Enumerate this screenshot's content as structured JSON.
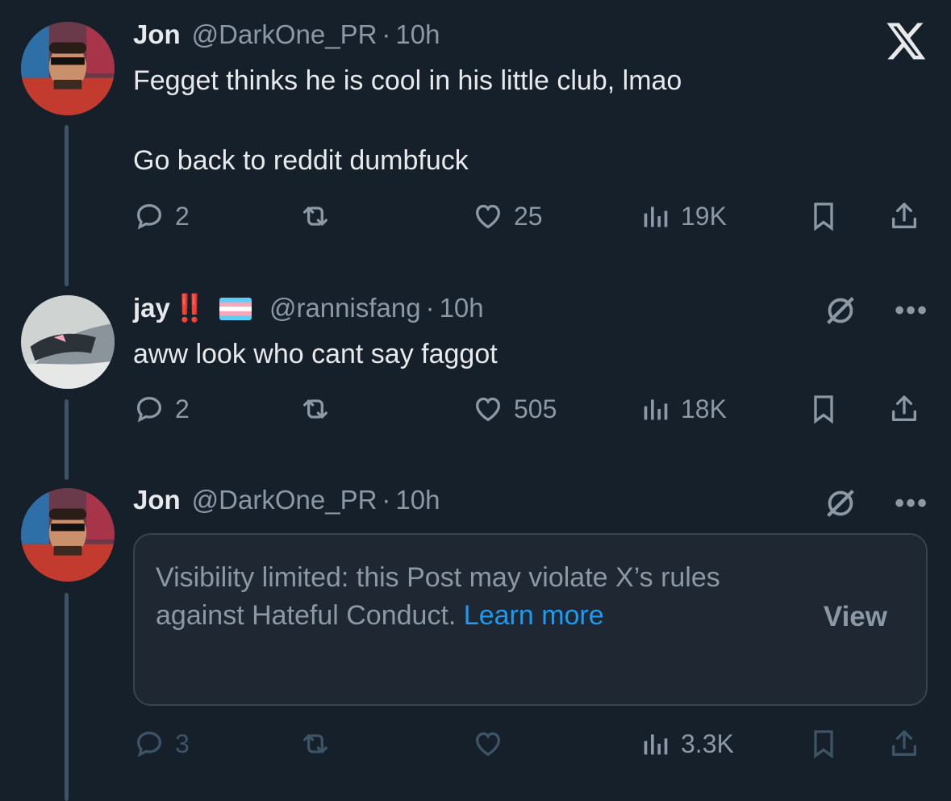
{
  "brand": {
    "logo_name": "x-logo",
    "color": "#e7e9ea"
  },
  "posts": [
    {
      "name": "Jon",
      "handle": "@DarkOne_PR",
      "dot": "·",
      "time": "10h",
      "text_lines": [
        "Fegget thinks he is cool in his little club, lmao",
        "Go back to reddit dumbfuck"
      ],
      "replies": "2",
      "reposts": "",
      "likes": "25",
      "views": "19K"
    },
    {
      "name": "jay",
      "name_suffix": "‼️",
      "handle": "@rannisfang",
      "dot": "·",
      "time": "10h",
      "text_lines": [
        "aww look who cant say faggot"
      ],
      "replies": "2",
      "reposts": "",
      "likes": "505",
      "views": "18K",
      "more_label": "•••"
    },
    {
      "name": "Jon",
      "handle": "@DarkOne_PR",
      "dot": "·",
      "time": "10h",
      "notice_text": "Visibility limited: this Post may violate X’s rules against Hateful Conduct. ",
      "notice_link": "Learn more",
      "view_label": "View",
      "replies": "3",
      "reposts": "",
      "likes": "",
      "views": "3.3K",
      "more_label": "•••"
    }
  ],
  "colors": {
    "background": "#15202b",
    "muted": "#8b98a5",
    "link": "#1d9bf0",
    "alert": "#e0245e"
  }
}
